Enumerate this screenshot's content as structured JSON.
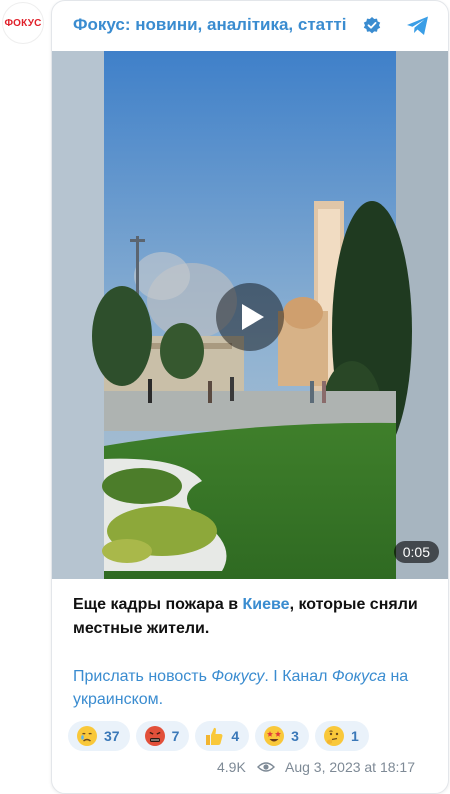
{
  "channel": {
    "avatar_text": "ФОКУС",
    "title": "Фокус: новини, аналітика, статті"
  },
  "video": {
    "duration": "0:05"
  },
  "post": {
    "text_part1": "Еще кадры пожара в ",
    "text_link": "Киеве",
    "text_part2": ", которые сняли местные жители.",
    "links": {
      "link1_prefix": "Прислать новость ",
      "link1_italic": "Фокусу",
      "link1_suffix": ".",
      "separator": " I ",
      "link2_prefix": "Канал ",
      "link2_italic": "Фокуса",
      "link2_suffix": " на украинском."
    }
  },
  "reactions": [
    {
      "icon": "crying-face-icon",
      "count": "37"
    },
    {
      "icon": "angry-face-icon",
      "count": "7"
    },
    {
      "icon": "thumbs-up-icon",
      "count": "4"
    },
    {
      "icon": "star-struck-icon",
      "count": "3"
    },
    {
      "icon": "thinking-face-icon",
      "count": "1"
    }
  ],
  "meta": {
    "views": "4.9K",
    "date": "Aug 3, 2023 at 18:17"
  },
  "colors": {
    "accent": "#3a8cd0",
    "brand_red": "#e0202a",
    "reaction_bg": "#eaf2fa"
  }
}
